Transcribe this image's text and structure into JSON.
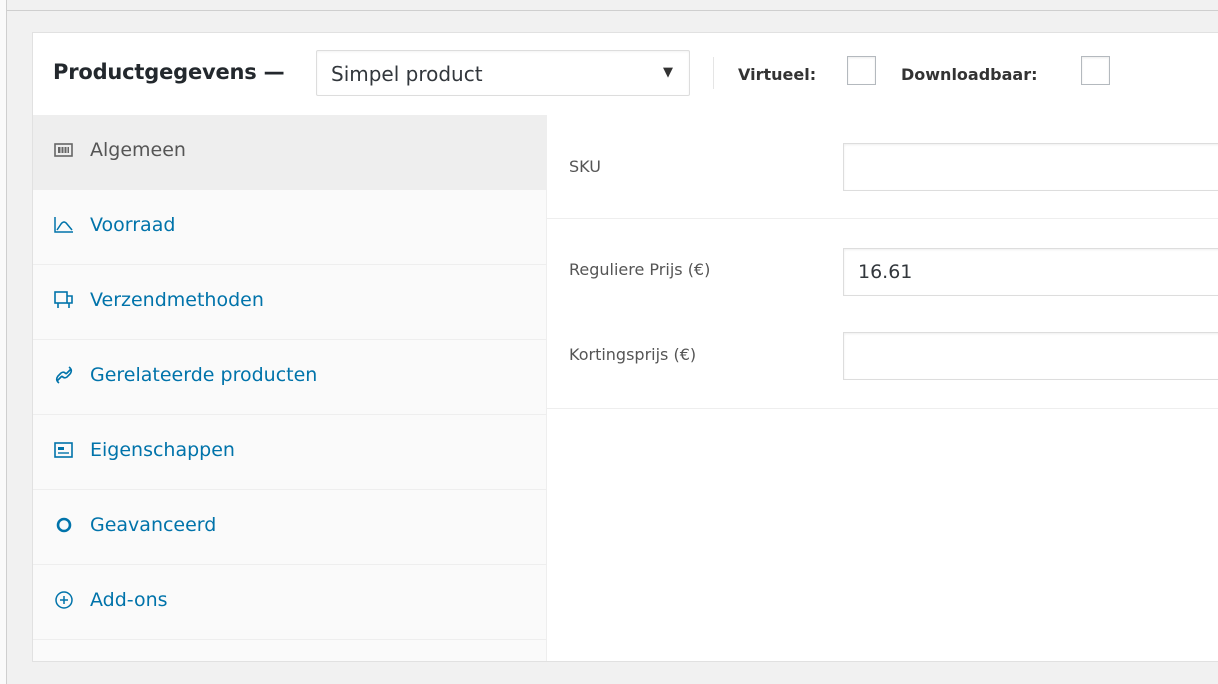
{
  "header": {
    "title": "Productgegevens —",
    "product_type": "Simpel product",
    "caret": "▼",
    "virtual_label": "Virtueel:",
    "virtual_checked": false,
    "downloadable_label": "Downloadbaar:",
    "downloadable_checked": false
  },
  "tabs": [
    {
      "label": "Algemeen",
      "icon": "general-icon",
      "active": true
    },
    {
      "label": "Voorraad",
      "icon": "inventory-icon",
      "active": false
    },
    {
      "label": "Verzendmethoden",
      "icon": "shipping-icon",
      "active": false
    },
    {
      "label": "Gerelateerde producten",
      "icon": "link-icon",
      "active": false
    },
    {
      "label": "Eigenschappen",
      "icon": "attributes-icon",
      "active": false
    },
    {
      "label": "Geavanceerd",
      "icon": "gear-icon",
      "active": false
    },
    {
      "label": "Add-ons",
      "icon": "add-circle-icon",
      "active": false
    }
  ],
  "general": {
    "sku_label": "SKU",
    "sku_value": "",
    "regular_price_label": "Reguliere Prijs (€)",
    "regular_price_value": "16.61",
    "sale_price_label": "Kortingsprijs (€)",
    "sale_price_value": ""
  },
  "colors": {
    "accent": "#0073aa",
    "active_tab_bg": "#eeeeee",
    "tabs_bg": "#fafafa"
  }
}
